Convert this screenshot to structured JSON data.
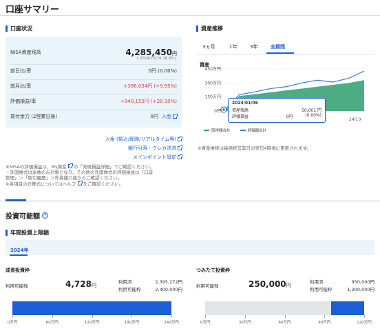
{
  "page_title": "口座サマリー",
  "account": {
    "section_title": "口座状況",
    "nisa_label": "NISA資産残高",
    "nisa_value": "4,285,450",
    "unit": "円",
    "nisa_date": "( 2024/10/19 16:29 )",
    "rows": [
      {
        "label": "前日比/率",
        "value": "0円 (0.00%)",
        "color": "normal"
      },
      {
        "label": "前月比/率",
        "value": "+388,034円 (+9.95%)",
        "color": "red"
      },
      {
        "label": "評価損益/率",
        "value": "+940,152円 (+28.10%)",
        "color": "red"
      },
      {
        "label": "買付余力 (2営業日後)",
        "value": "0円",
        "color": "normal"
      }
    ],
    "deposit_link": "入金",
    "links": [
      "入金 (振込/即時/リアルタイム等)",
      "銀行引落・クレカ決済",
      "メインポイント設定"
    ],
    "notes": [
      "※NISAの評価損益は、My資産",
      "の「実現損益詳細」でご確認ください。",
      "・外国株式は米株のみ対象となり、その他の外国株式の評価損益は「口座",
      "管理」＞「取引履歴」＞外貨建口座からご確認ください。",
      "※各項目の計算式についてはヘルプ",
      "をご確認ください。"
    ]
  },
  "trend": {
    "section_title": "資産推移",
    "tabs": [
      "3ヵ月",
      "1年",
      "3年",
      "全期間"
    ],
    "active_tab": "全期間",
    "ylabel": "資産",
    "yticks": [
      "450万円",
      "300万円",
      "150万円",
      "0円"
    ],
    "xtick": "24/10",
    "tooltip": {
      "date": "2024/01/06",
      "rows": [
        {
          "label": "資産残高",
          "value": "50,001 円"
        },
        {
          "label": "評価損益",
          "value": "0円",
          "pct": "(0.00%)"
        }
      ]
    },
    "legend": [
      "取得額合計",
      "評価額合計"
    ],
    "footnote": "※資産推移は毎週終営業日の翌日4時頃に更新されます。",
    "colors": {
      "acquired": "#2e9e6e",
      "valuation": "#3a7bd5"
    }
  },
  "chart_data": {
    "type": "area",
    "x": [
      "2024/01",
      "2024/02",
      "2024/03",
      "2024/04",
      "2024/05",
      "2024/06",
      "2024/07",
      "2024/08",
      "2024/09",
      "2024/10"
    ],
    "series": [
      {
        "name": "取得額合計",
        "values": [
          0.5,
          160,
          180,
          200,
          220,
          240,
          260,
          280,
          300,
          330
        ]
      },
      {
        "name": "評価額合計",
        "values": [
          0.5,
          175,
          205,
          240,
          260,
          300,
          330,
          310,
          350,
          428
        ]
      }
    ],
    "ylim": [
      0,
      450
    ]
  },
  "invest": {
    "title": "投資可能額",
    "subtitle": "年間投資上限額",
    "year_tab": "2024年",
    "growth": {
      "title": "成長投資枠",
      "remain_label": "利用可能残",
      "remain_value": "4,728",
      "unit": "円",
      "used_label": "利用済",
      "used_value": "2,395,272円",
      "limit_label": "利用可能枠",
      "limit_value": "2,400,000円",
      "fill_fraction": 0.998,
      "ticks": [
        "0万円",
        "60万円",
        "120万円",
        "180万円",
        "240万円"
      ]
    },
    "tsumitate": {
      "title": "つみたて投資枠",
      "remain_label": "利用可能残",
      "remain_value": "250,000",
      "unit": "円",
      "used_label": "利用済",
      "used_value": "950,000円",
      "limit_label": "利用可能枠",
      "limit_value": "1,200,000円",
      "fill_fraction": 0.208,
      "ticks": [
        "0万円",
        "30万円",
        "60万円",
        "90万円",
        "120万円"
      ]
    }
  }
}
